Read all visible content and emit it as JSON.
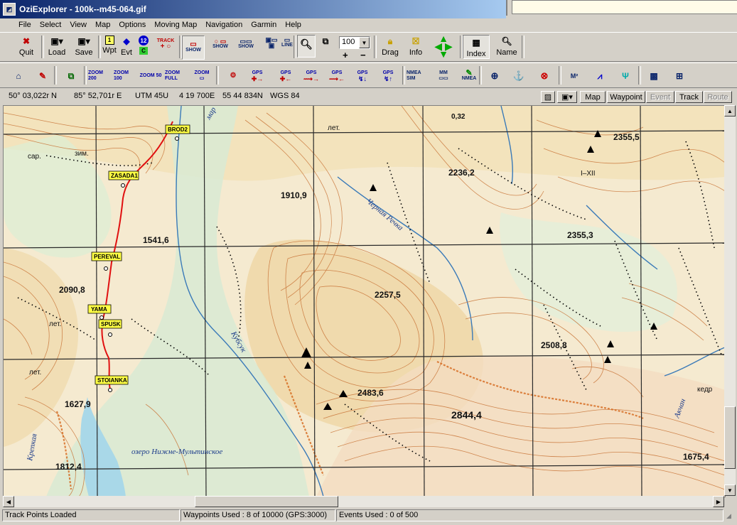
{
  "window": {
    "title": "OziExplorer - 100k--m45-064.gif"
  },
  "menu": [
    "File",
    "Select",
    "View",
    "Map",
    "Options",
    "Moving Map",
    "Navigation",
    "Garmin",
    "Help"
  ],
  "toolbar1": {
    "quit": "Quit",
    "load": "Load",
    "save": "Save",
    "wpt": "Wpt",
    "evt": "Evt",
    "track_label": "TRACK",
    "show1": "SHOW",
    "show2": "SHOW",
    "show3": "SHOW",
    "line": "LINE",
    "zoom_value": "100",
    "drag": "Drag",
    "info": "Info",
    "index": "Index",
    "name": "Name",
    "wpt_num": "1",
    "evt_num": "12",
    "c": "C"
  },
  "toolbar2": {
    "zoom200": "ZOOM 200",
    "zoom100": "ZOOM 100",
    "zoom50": "ZOOM 50",
    "zoomfull": "ZOOM FULL",
    "zoom_small": "ZOOM",
    "gps": "GPS",
    "nmea_sim": "NMEA SIM",
    "mm": "MM",
    "nmea": "NMEA",
    "m2": "M²"
  },
  "position": {
    "lat": "50° 03,022r N",
    "lon": "85° 52,701r E",
    "utm_zone": "UTM  45U",
    "easting": "4 19 700E",
    "northing": "55 44 834N",
    "datum": "WGS 84"
  },
  "map_buttons": {
    "map": "Map",
    "waypoint": "Waypoint",
    "event": "Event",
    "track": "Track",
    "route": "Route"
  },
  "waypoints": [
    "BROD2",
    "ZASADA1",
    "PEREVAL",
    "YAMA",
    "SPUSK",
    "STOIANKA"
  ],
  "map_labels": {
    "h1": "1910,9",
    "h2": "2236,2",
    "h3": "2355,5",
    "h4": "2355,3",
    "h5": "1541,6",
    "h6": "2090,8",
    "h7": "2257,5",
    "h8": "2508,8",
    "h9": "2483,6",
    "h10": "2844,4",
    "h11": "1627,9",
    "h12": "1812,4",
    "h13": "1675,4",
    "h14": "0,32",
    "lake": "озеро Нижне-Мультинское",
    "river1": "Черная Речка",
    "river2": "Крепкая",
    "river3": "Кубсук",
    "lake2": "зим.",
    "sar": "сар.",
    "let1": "лет.",
    "let2": "лет.",
    "let3": "лет.",
    "kedr": "кедр",
    "akchan": "Акчан",
    "ixii": "I–XII",
    "mar": "мар"
  },
  "status": {
    "track": "Track Points Loaded",
    "waypoints": "Waypoints Used : 8 of 10000  (GPS:3000)",
    "events": "Events Used : 0 of 500"
  }
}
